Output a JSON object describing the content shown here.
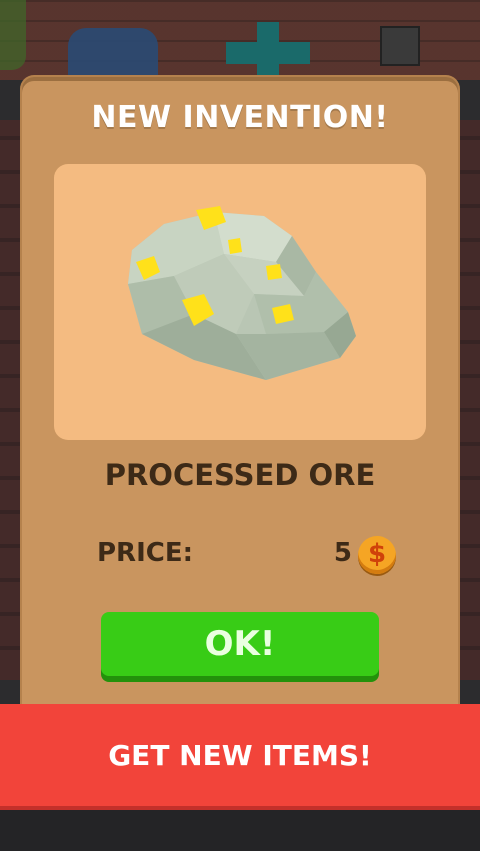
{
  "dialog": {
    "title": "NEW INVENTION!",
    "item_name": "PROCESSED ORE",
    "price_label": "PRICE:",
    "price_value": "5",
    "currency_icon": "dollar-coin-icon",
    "ok_label": "OK!"
  },
  "banner": {
    "label": "GET NEW ITEMS!"
  },
  "colors": {
    "dialog_bg": "#c9955f",
    "preview_bg": "#f4bb81",
    "ok_button": "#38cc16",
    "banner": "#f2443a",
    "coin": "#f5a524",
    "text_dark": "#3d2a17"
  }
}
